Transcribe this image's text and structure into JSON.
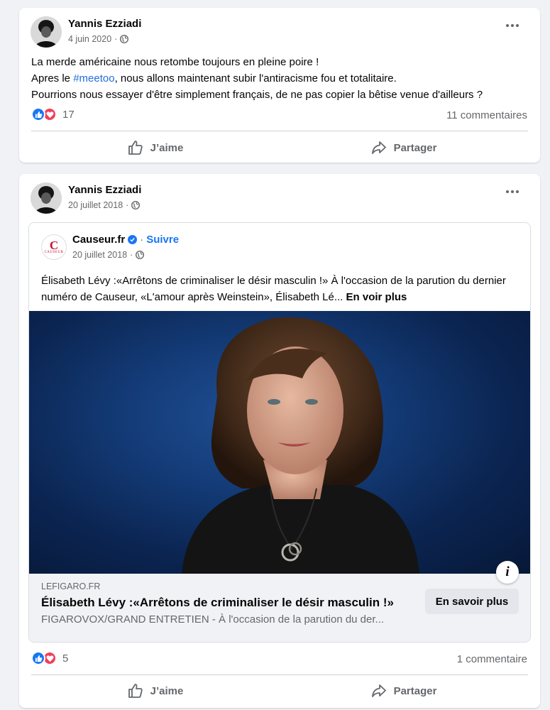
{
  "posts": [
    {
      "author": "Yannis Ezziadi",
      "date": "4 juin 2020",
      "text": {
        "line1": "La merde américaine nous retombe toujours en pleine poire !",
        "line2_before": "Apres le ",
        "hashtag": "#meetoo",
        "line2_after": ", nous allons maintenant subir l'antiracisme fou et totalitaire.",
        "line3": "Pourrions nous essayer d'être simplement français, de ne pas copier la bêtise venue d'ailleurs ?"
      },
      "reaction_count": "17",
      "comments": "11 commentaires",
      "like_label": "J’aime",
      "share_label": "Partager"
    },
    {
      "author": "Yannis Ezziadi",
      "date": "20 juillet 2018",
      "shared": {
        "source_name": "Causeur.fr",
        "logo_letter": "C",
        "logo_word": "CAUSEUR",
        "separator": "·",
        "follow_label": "Suivre",
        "date": "20 juillet 2018",
        "text": "Élisabeth Lévy :«Arrêtons de criminaliser le désir masculin !» À l'occasion de la parution du dernier numéro de Causeur, «L'amour après Weinstein», Élisabeth Lé...",
        "see_more": "En voir plus",
        "link": {
          "domain": "LEFIGARO.FR",
          "title": "Élisabeth Lévy :«Arrêtons de criminaliser le désir masculin !»",
          "description": "FIGAROVOX/GRAND ENTRETIEN - À l'occasion de la parution du der...",
          "button": "En savoir plus"
        }
      },
      "reaction_count": "5",
      "comments": "1 commentaire",
      "like_label": "J’aime",
      "share_label": "Partager"
    }
  ],
  "colors": {
    "accent": "#1877f2",
    "like": "#1877f2",
    "love": "#f33e58",
    "hashtag": "#216fdb",
    "secondary_text": "#65676b"
  },
  "icons": [
    "globe-icon",
    "more-options-icon",
    "like-reaction-icon",
    "love-reaction-icon",
    "thumbs-up-icon",
    "share-icon",
    "verified-badge-icon",
    "info-icon"
  ]
}
